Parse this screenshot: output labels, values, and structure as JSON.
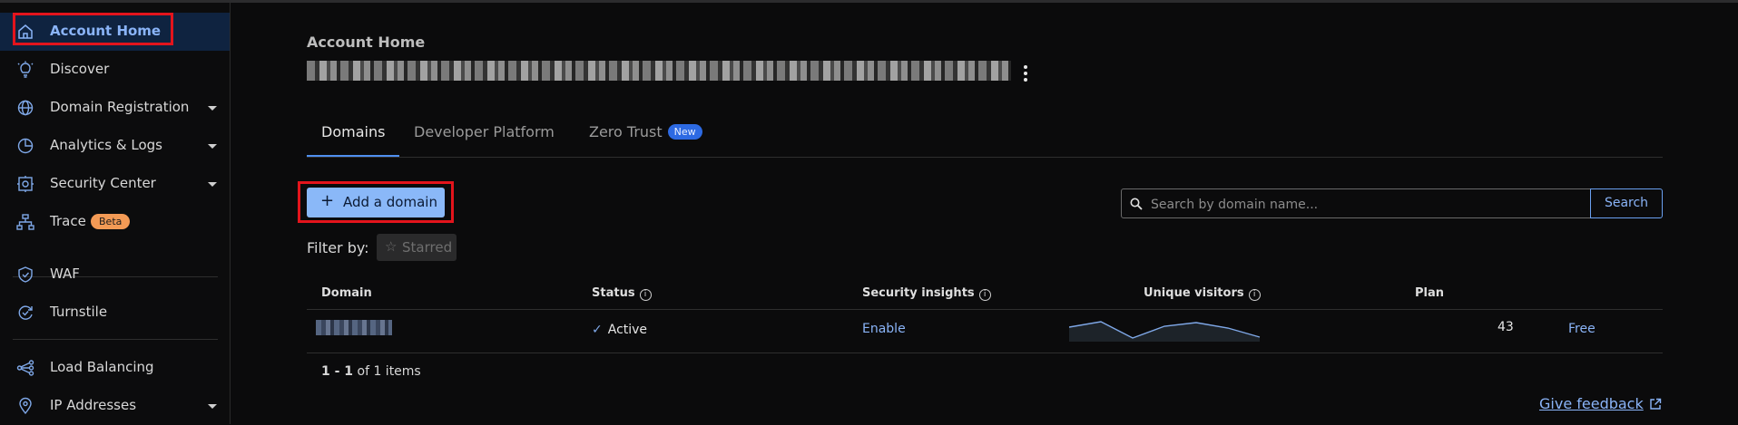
{
  "sidebar": {
    "items": [
      {
        "label": "Account Home",
        "icon": "home-icon",
        "active": true
      },
      {
        "label": "Discover",
        "icon": "lightbulb-icon"
      },
      {
        "label": "Domain Registration",
        "icon": "globe-icon",
        "expandable": true
      },
      {
        "label": "Analytics & Logs",
        "icon": "pie-chart-icon",
        "expandable": true
      },
      {
        "label": "Security Center",
        "icon": "security-center-icon",
        "expandable": true
      },
      {
        "label": "Trace",
        "icon": "trace-icon",
        "badge": "Beta"
      },
      {
        "label": "WAF",
        "icon": "shield-icon"
      },
      {
        "label": "Turnstile",
        "icon": "turnstile-icon"
      },
      {
        "label": "Load Balancing",
        "icon": "load-balancing-icon"
      },
      {
        "label": "IP Addresses",
        "icon": "location-pin-icon",
        "expandable": true
      }
    ]
  },
  "header": {
    "section_label": "Account Home"
  },
  "tabs": [
    {
      "label": "Domains",
      "active": true
    },
    {
      "label": "Developer Platform"
    },
    {
      "label": "Zero Trust",
      "badge": "New"
    }
  ],
  "toolbar": {
    "add_domain_label": "Add a domain",
    "filter_label": "Filter by:",
    "starred_label": "Starred",
    "search_placeholder": "Search by domain name...",
    "search_button_label": "Search"
  },
  "table": {
    "columns": [
      "Domain",
      "Status",
      "Security insights",
      "Unique visitors",
      "Plan"
    ],
    "rows": [
      {
        "status": "Active",
        "security_insights": "Enable",
        "unique_visitors": "43",
        "plan": "Free"
      }
    ]
  },
  "pagination": {
    "range": "1 - 1",
    "of_text": "of 1 items"
  },
  "footer": {
    "feedback_label": "Give feedback"
  },
  "colors": {
    "accent": "#8ab4f8",
    "background": "#0b0b0c",
    "highlight": "#e3141c",
    "beta_badge": "#f39a55",
    "new_badge": "#2d6ae3"
  }
}
